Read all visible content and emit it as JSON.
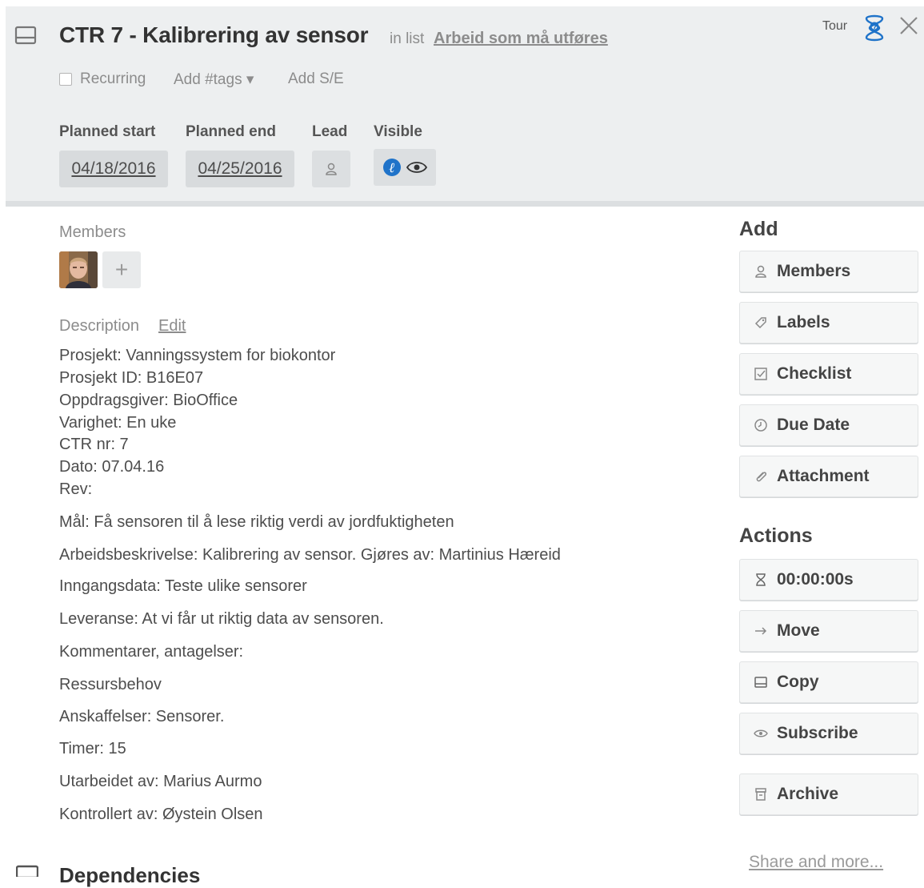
{
  "card": {
    "title": "CTR 7 - Kalibrering av sensor",
    "in_list_prefix": "in list",
    "list_name": "Arbeid som må utføres"
  },
  "topbar": {
    "tour_label": "Tour",
    "tour_icon": "tour-icon",
    "close_icon": "close-icon"
  },
  "options": {
    "recurring_label": "Recurring",
    "recurring_checked": false,
    "add_tags_label": "Add #tags ▾",
    "add_se_label": "Add S/E"
  },
  "fields": {
    "planned_start_label": "Planned start",
    "planned_start_value": "04/18/2016",
    "planned_end_label": "Planned end",
    "planned_end_value": "04/25/2016",
    "lead_label": "Lead",
    "lead_icon": "person-icon",
    "visible_label": "Visible",
    "visible_icons": [
      "team-badge-icon",
      "eye-icon"
    ]
  },
  "members": {
    "label": "Members",
    "add_symbol": "+"
  },
  "description": {
    "label": "Description",
    "edit_label": "Edit",
    "lines": [
      "Prosjekt: Vanningssystem for biokontor",
      "Prosjekt ID: B16E07",
      "Oppdragsgiver: BioOffice",
      "Varighet: En uke",
      "CTR nr: 7",
      "Dato: 07.04.16",
      "Rev:",
      "Mål: Få sensoren til å lese riktig verdi av jordfuktigheten",
      "Arbeidsbeskrivelse: Kalibrering av sensor. Gjøres av: Martinius Hæreid",
      "Inngangsdata: Teste ulike sensorer",
      "Leveranse: At vi får ut riktig data av sensoren.",
      "Kommentarer, antagelser:",
      "Ressursbehov",
      "Anskaffelser: Sensorer.",
      "Timer: 15",
      "Utarbeidet av: Marius Aurmo",
      "Kontrollert av: Øystein Olsen"
    ]
  },
  "dependencies": {
    "label": "Dependencies"
  },
  "sidebar": {
    "add_heading": "Add",
    "add_items": [
      {
        "label": "Members",
        "icon": "person-icon"
      },
      {
        "label": "Labels",
        "icon": "tag-icon"
      },
      {
        "label": "Checklist",
        "icon": "checklist-icon"
      },
      {
        "label": "Due Date",
        "icon": "clock-icon"
      },
      {
        "label": "Attachment",
        "icon": "paperclip-icon"
      }
    ],
    "actions_heading": "Actions",
    "action_items": [
      {
        "label": "00:00:00s",
        "icon": "hourglass-icon"
      },
      {
        "label": "Move",
        "icon": "arrow-right-icon"
      },
      {
        "label": "Copy",
        "icon": "card-icon"
      },
      {
        "label": "Subscribe",
        "icon": "eye-icon"
      },
      {
        "label": "Archive",
        "icon": "archive-icon"
      }
    ],
    "share_label": "Share and more..."
  },
  "colors": {
    "header_bg": "#edeff0",
    "badge_blue": "#1f73c9"
  }
}
